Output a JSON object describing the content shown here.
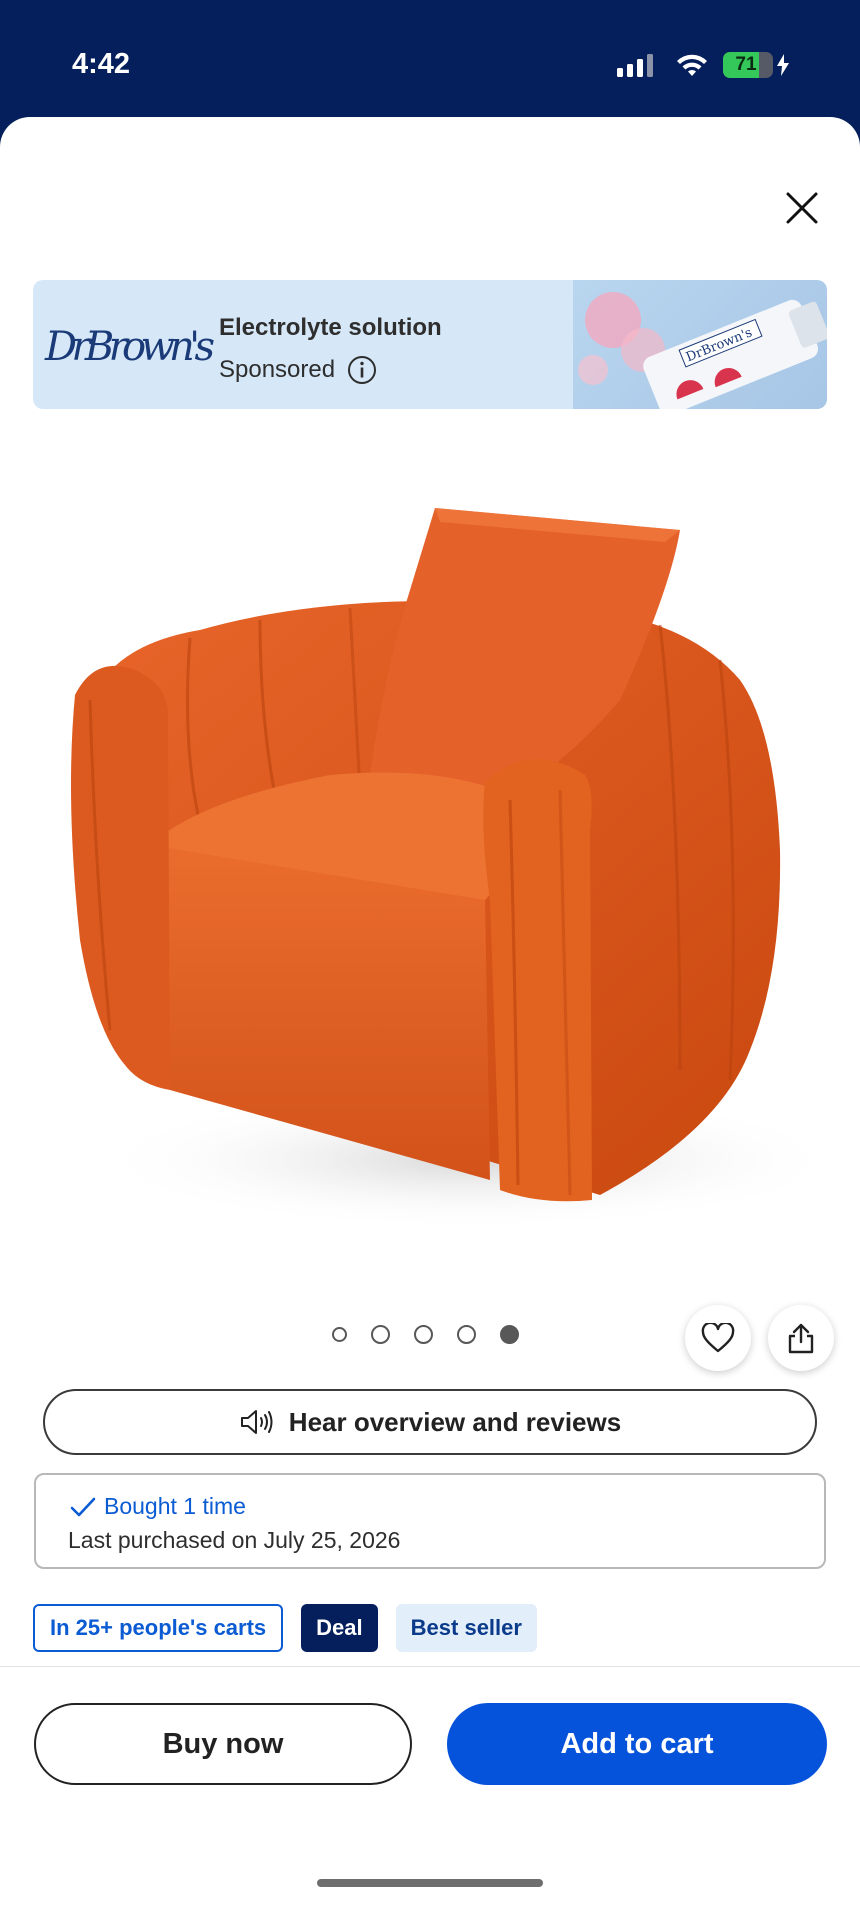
{
  "status_bar": {
    "time": "4:42",
    "battery_level": "71",
    "battery_fraction": 0.71,
    "icons": [
      "cellular-signal-icon",
      "wifi-icon",
      "battery-icon",
      "charging-bolt-icon"
    ]
  },
  "sheet": {
    "close_icon": "close-icon"
  },
  "ad": {
    "brand_logo_text": "DrBrown's",
    "title": "Electrolyte solution",
    "sponsored_label": "Sponsored",
    "info_icon": "info-icon"
  },
  "product": {
    "image_alt": "orange-velvet-swivel-armchair",
    "image_count": 5,
    "active_image_index": 5
  },
  "actions": {
    "favorite_icon": "heart-icon",
    "share_icon": "share-icon"
  },
  "hear_overview": {
    "label": "Hear overview and reviews",
    "icon": "speaker-icon"
  },
  "purchase_history": {
    "bought_label": "Bought 1 time",
    "last_purchased": "Last purchased on July 25, 2026"
  },
  "tags": {
    "carts": "In 25+ people's carts",
    "deal": "Deal",
    "best_seller": "Best seller"
  },
  "bottom_bar": {
    "buy_now": "Buy now",
    "add_to_cart": "Add to cart"
  },
  "colors": {
    "header_bg": "#041f5c",
    "primary_blue": "#0653db",
    "link_blue": "#0b5bd3",
    "chair_orange": "#e4571c"
  }
}
